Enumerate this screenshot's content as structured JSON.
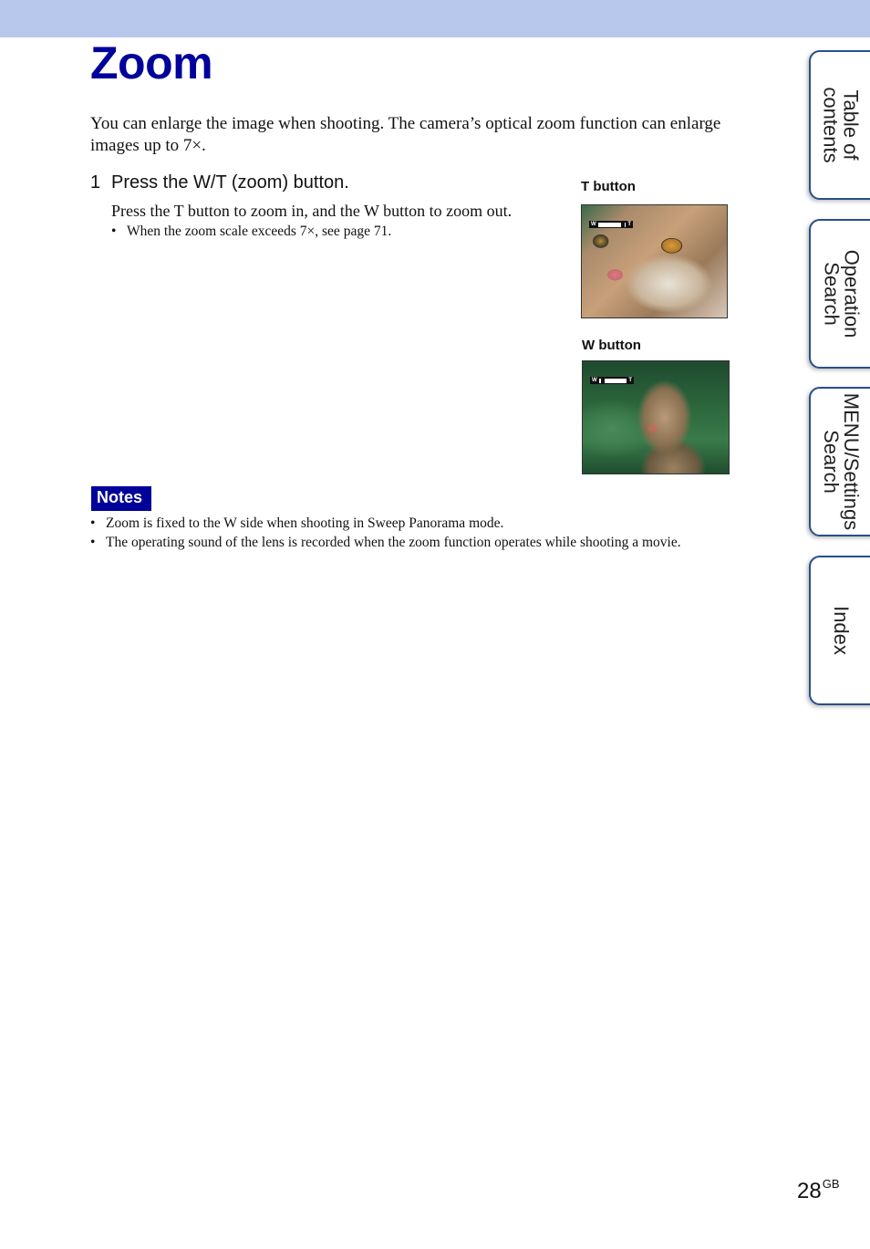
{
  "header": {
    "title": "Zoom",
    "band_color": "#b8c7ec",
    "title_color": "#00009a"
  },
  "intro": "You can enlarge the image when shooting. The camera’s optical zoom function can enlarge images up to 7×.",
  "steps": [
    {
      "number": "1",
      "heading": "Press the W/T (zoom) button.",
      "body": "Press the T button to zoom in, and the W button to zoom out.",
      "bullets": [
        "When the zoom scale exceeds 7×, see page 71."
      ]
    }
  ],
  "figures": [
    {
      "label": "T button",
      "image": "cat-close-up-photo",
      "zoom_bar": {
        "w": "W",
        "t": "T",
        "level": 0.92
      }
    },
    {
      "label": "W button",
      "image": "cat-wide-photo",
      "zoom_bar": {
        "w": "W",
        "t": "T",
        "level": 0.08
      }
    }
  ],
  "notes": {
    "badge": "Notes",
    "items": [
      "Zoom is fixed to the W side when shooting in Sweep Panorama mode.",
      "The operating sound of the lens is recorded when the zoom function operates while shooting a movie."
    ]
  },
  "side_tabs": [
    {
      "label": "Table of\ncontents"
    },
    {
      "label": "Operation\nSearch"
    },
    {
      "label": "MENU/Settings\nSearch"
    },
    {
      "label": "Index"
    }
  ],
  "footer": {
    "page_number": "28",
    "suffix": "GB"
  }
}
